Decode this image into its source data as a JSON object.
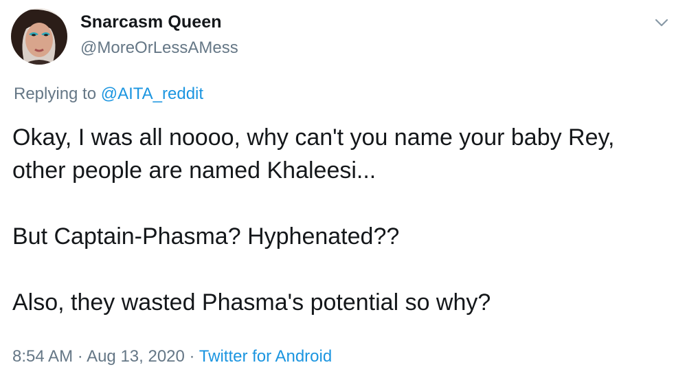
{
  "tweet": {
    "display_name": "Snarcasm Queen",
    "handle": "@MoreOrLessAMess",
    "menu_icon": "chevron-down-icon",
    "avatar_icon": "user-avatar-photo",
    "replying_prefix": "Replying to",
    "replying_to": "@AITA_reddit",
    "lines": [
      "Okay, I was all noooo, why can't you name your baby Rey,",
      "other people are named Khaleesi...",
      "But Captain-Phasma? Hyphenated??",
      "Also, they wasted Phasma's potential so why?"
    ],
    "time": "8:54 AM",
    "separator": "·",
    "date": "Aug 13, 2020",
    "source": "Twitter for Android"
  },
  "colors": {
    "text": "#14171a",
    "secondary": "#657786",
    "link": "#1b95e0",
    "background": "#ffffff"
  }
}
